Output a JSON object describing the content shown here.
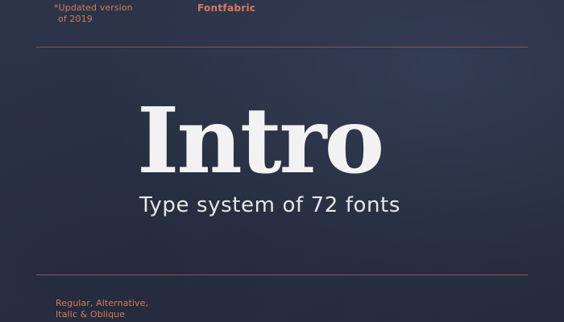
{
  "top_note": {
    "line1": "*Updated version",
    "line2": "of 2019"
  },
  "brand": "Fontfabric",
  "title": "Intro",
  "subtitle": "Type system of 72 fonts",
  "bottom_note": {
    "line1": "Regular, Alternative,",
    "line2": "Italic & Oblique"
  },
  "colors": {
    "background": "#283043",
    "accent": "#d8795a",
    "title": "#f2f2f2",
    "rule": "#8a5546"
  }
}
